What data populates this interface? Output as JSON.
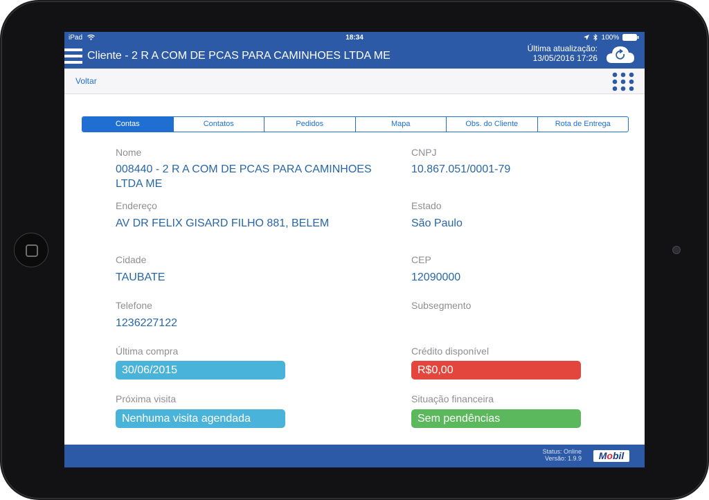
{
  "status_bar": {
    "device": "iPad",
    "time": "18:34",
    "battery": "100%"
  },
  "header": {
    "title": "Cliente - 2 R A COM DE PCAS PARA CAMINHOES LTDA ME",
    "last_update_label": "Última atualização:",
    "last_update_value": "13/05/2016 17:26"
  },
  "toolbar": {
    "back_label": "Voltar"
  },
  "tabs": [
    {
      "label": "Contas",
      "active": true
    },
    {
      "label": "Contatos"
    },
    {
      "label": "Pedidos"
    },
    {
      "label": "Mapa"
    },
    {
      "label": "Obs. do Cliente"
    },
    {
      "label": "Rota de Entrega"
    }
  ],
  "fields": {
    "nome": {
      "label": "Nome",
      "value": "008440 - 2 R A COM DE PCAS PARA CAMINHOES LTDA ME"
    },
    "cnpj": {
      "label": "CNPJ",
      "value": "10.867.051/0001-79"
    },
    "endereco": {
      "label": "Endereço",
      "value": "AV DR FELIX GISARD FILHO 881, BELEM"
    },
    "estado": {
      "label": "Estado",
      "value": "São Paulo"
    },
    "cidade": {
      "label": "Cidade",
      "value": "TAUBATE"
    },
    "cep": {
      "label": "CEP",
      "value": "12090000"
    },
    "telefone": {
      "label": "Telefone",
      "value": "1236227122"
    },
    "subsegmento": {
      "label": "Subsegmento",
      "value": ""
    },
    "ultima_compra": {
      "label": "Última compra",
      "value": "30/06/2015",
      "color": "#4ab3d9"
    },
    "credito": {
      "label": "Crédito disponível",
      "value": "R$0,00",
      "color": "#e2463c"
    },
    "proxima_visita": {
      "label": "Próxima visita",
      "value": "Nenhuma visita agendada",
      "color": "#4ab3d9"
    },
    "situacao": {
      "label": "Situação financeira",
      "value": "Sem pendências",
      "color": "#5cb85c"
    }
  },
  "footer": {
    "status": "Status: Online",
    "version": "Versão: 1.9.9",
    "logo": "Mobil"
  },
  "colors": {
    "header": "#2c5aa6",
    "accent": "#1f6fd3",
    "value_text": "#2766a8"
  },
  "icons": [
    "menu-icon",
    "cloud-sync-icon",
    "grid-menu-icon",
    "wifi-icon",
    "location-arrow-icon",
    "bluetooth-icon",
    "battery-icon"
  ]
}
